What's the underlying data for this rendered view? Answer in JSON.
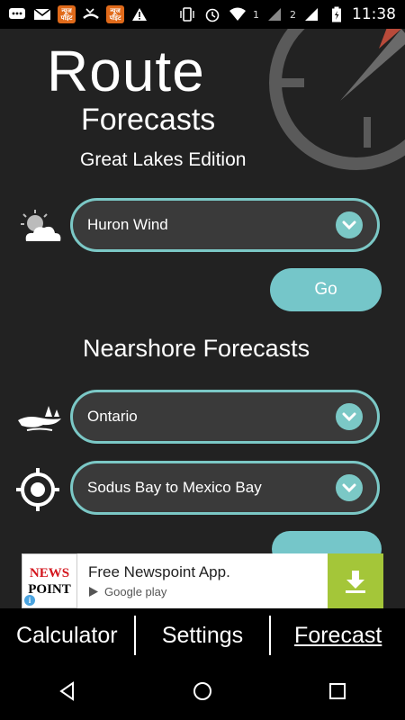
{
  "status_bar": {
    "badge1": "न्यूज\nपॉइंट",
    "badge2": "न्यूज\nपॉइंट",
    "sim1": "1",
    "sim2": "2",
    "time": "11:38"
  },
  "header": {
    "title_line1": "Route",
    "title_line2": "Forecasts",
    "subtitle": "Great Lakes Edition"
  },
  "route": {
    "selected": "Huron Wind",
    "go_label": "Go"
  },
  "nearshore": {
    "title": "Nearshore Forecasts",
    "lake_selected": "Ontario",
    "zone_selected": "Sodus Bay to Mexico Bay"
  },
  "ad": {
    "logo_line1": "NEWS",
    "logo_line2": "POINT",
    "title": "Free Newspoint App.",
    "store": "Google play"
  },
  "tabs": {
    "calculator": "Calculator",
    "settings": "Settings",
    "forecast": "Forecast"
  },
  "colors": {
    "accent": "#7bc8c6",
    "background": "#222222",
    "ad_download": "#a4c639"
  }
}
